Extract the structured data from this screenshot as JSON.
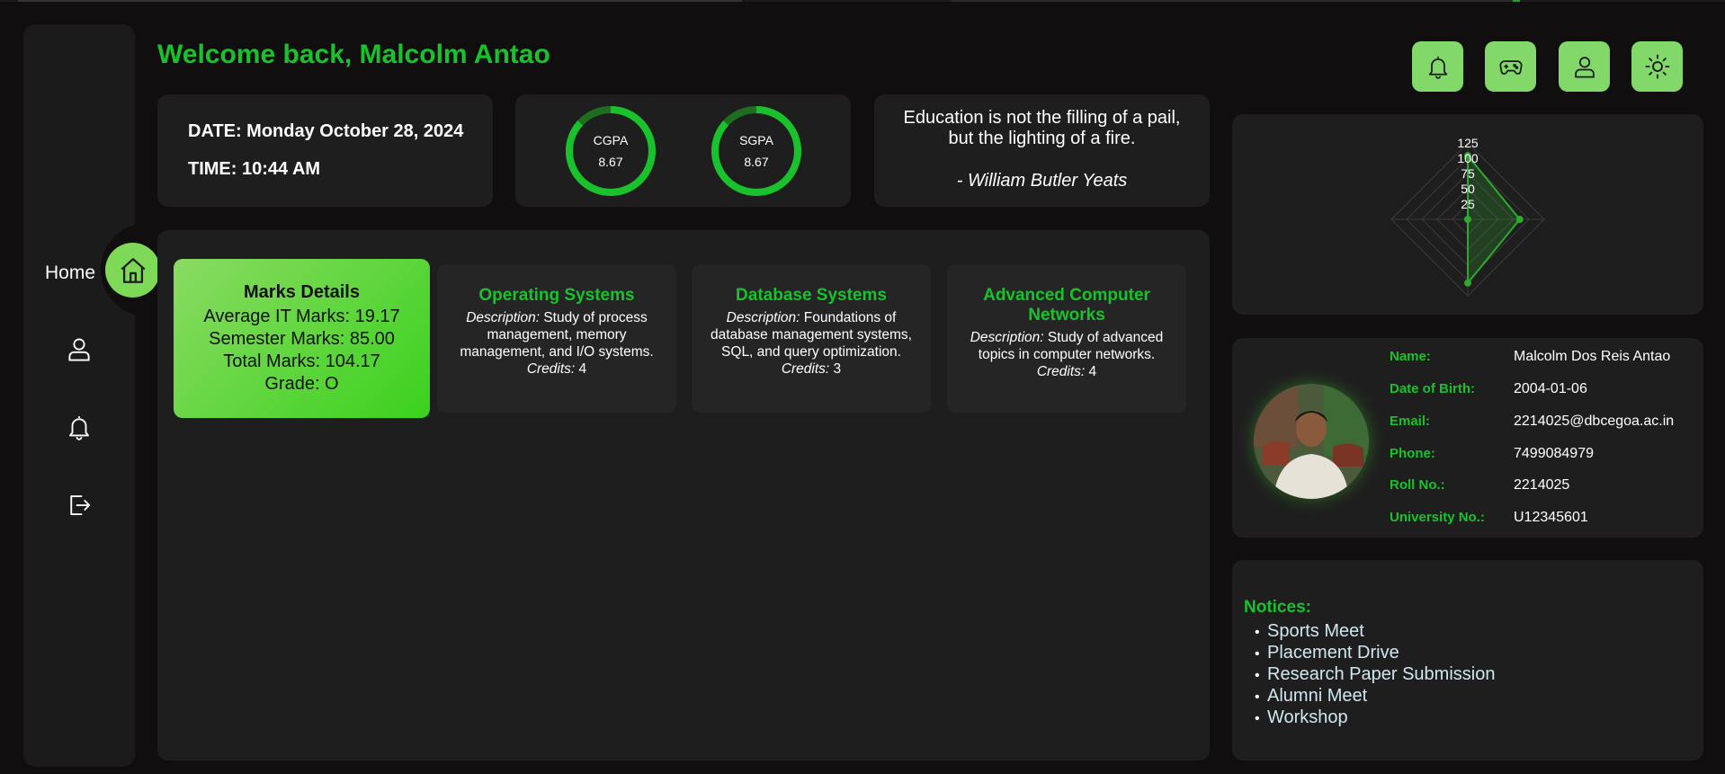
{
  "header": {
    "welcome": "Welcome back, Malcolm Antao"
  },
  "top_buttons": [
    "bell-icon",
    "gamepad-icon",
    "user-icon",
    "sun-icon"
  ],
  "sidebar": {
    "home_label": "Home",
    "items": [
      "home-icon",
      "user-icon",
      "bell-icon",
      "logout-icon"
    ]
  },
  "datetime": {
    "date": "DATE: Monday October 28, 2024",
    "time": "TIME: 10:44 AM"
  },
  "gpa": {
    "cgpa": {
      "label": "CGPA",
      "value": "8.67",
      "fraction": 0.867
    },
    "sgpa": {
      "label": "SGPA",
      "value": "8.67",
      "fraction": 0.867
    }
  },
  "quote": {
    "line1": "Education is not the filling of a pail,",
    "line2": "but the lighting of a fire.",
    "author": "- William Butler Yeats"
  },
  "marks": {
    "title": "Marks Details",
    "avg": "Average IT Marks: 19.17",
    "semester": "Semester Marks: 85.00",
    "total": "Total Marks: 104.17",
    "grade": "Grade: O"
  },
  "courses": [
    {
      "title": "Operating Systems",
      "desc_label": "Description:",
      "desc": " Study of process management, memory management, and I/O systems.",
      "credits_label": "Credits:",
      "credits": " 4"
    },
    {
      "title": "Database Systems",
      "desc_label": "Description:",
      "desc": " Foundations of database management systems, SQL, and query optimization.",
      "credits_label": "Credits:",
      "credits": " 3"
    },
    {
      "title": "Advanced Computer Networks",
      "desc_label": "Description:",
      "desc": " Study of advanced topics in computer networks.",
      "credits_label": "Credits:",
      "credits": " 4"
    }
  ],
  "chart_data": {
    "type": "radar",
    "ticks": [
      "125",
      "100",
      "75",
      "50",
      "25"
    ],
    "rmax": 125,
    "series": [
      {
        "values": [
          104.17,
          85.0,
          104.17,
          0
        ]
      }
    ],
    "colors": {
      "line": "#2ea82e",
      "fill": "rgba(46,168,46,0.25)",
      "grid": "#3a3a3a"
    }
  },
  "profile": {
    "rows": [
      {
        "k": "Name:",
        "v": "Malcolm Dos Reis Antao"
      },
      {
        "k": "Date of Birth:",
        "v": "2004-01-06"
      },
      {
        "k": "Email:",
        "v": "2214025@dbcegoa.ac.in"
      },
      {
        "k": "Phone:",
        "v": "7499084979"
      },
      {
        "k": "Roll No.:",
        "v": "2214025"
      },
      {
        "k": "University No.:",
        "v": "U12345601"
      }
    ]
  },
  "notices": {
    "title": "Notices:",
    "items": [
      "Sports Meet",
      "Placement Drive",
      "Research Paper Submission",
      "Alumni Meet",
      "Workshop"
    ]
  },
  "colors": {
    "accent": "#19c22d",
    "button": "#83d86a",
    "card": "#1f1e1f",
    "background": "#100e0e"
  }
}
